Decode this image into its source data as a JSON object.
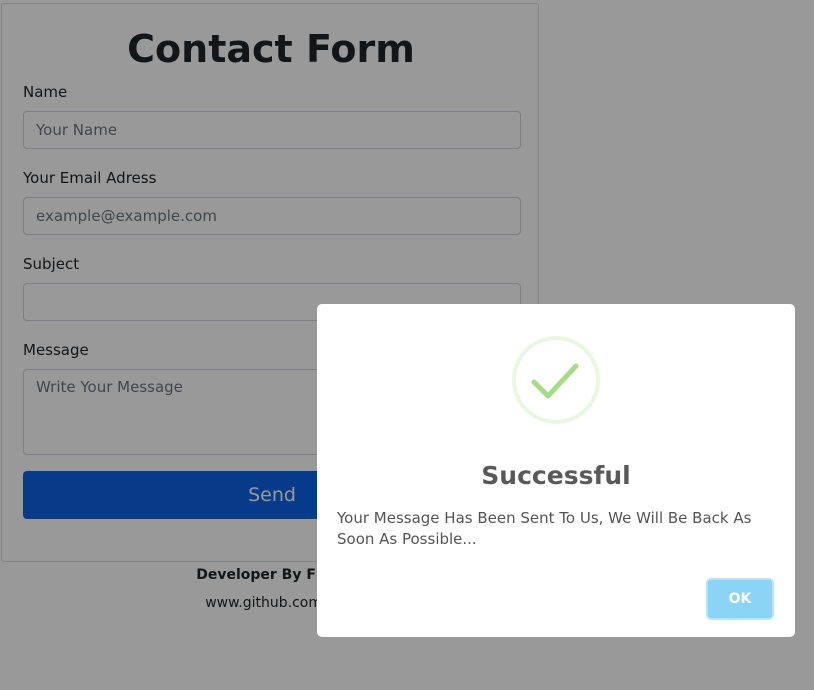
{
  "form": {
    "title": "Contact Form",
    "name_label": "Name",
    "name_placeholder": "Your Name",
    "email_label": "Your Email Adress",
    "email_placeholder": "example@example.com",
    "subject_label": "Subject",
    "subject_placeholder": "",
    "message_label": "Message",
    "message_placeholder": "Write Your Message",
    "send_label": "Send"
  },
  "footer": {
    "developer_credit": "Developer By Fırat",
    "link_text": "www.github.com/F"
  },
  "dialog": {
    "icon": "success-check-icon",
    "title": "Successful",
    "message": "Your Message Has Been Sent To Us, We Will Be Back As Soon As Possible...",
    "ok_label": "OK"
  },
  "colors": {
    "send_button": "#0b63e5",
    "ok_button": "#8cd4f5",
    "success_check": "#a5dc86",
    "overlay": "rgba(0,0,0,0.4)"
  }
}
